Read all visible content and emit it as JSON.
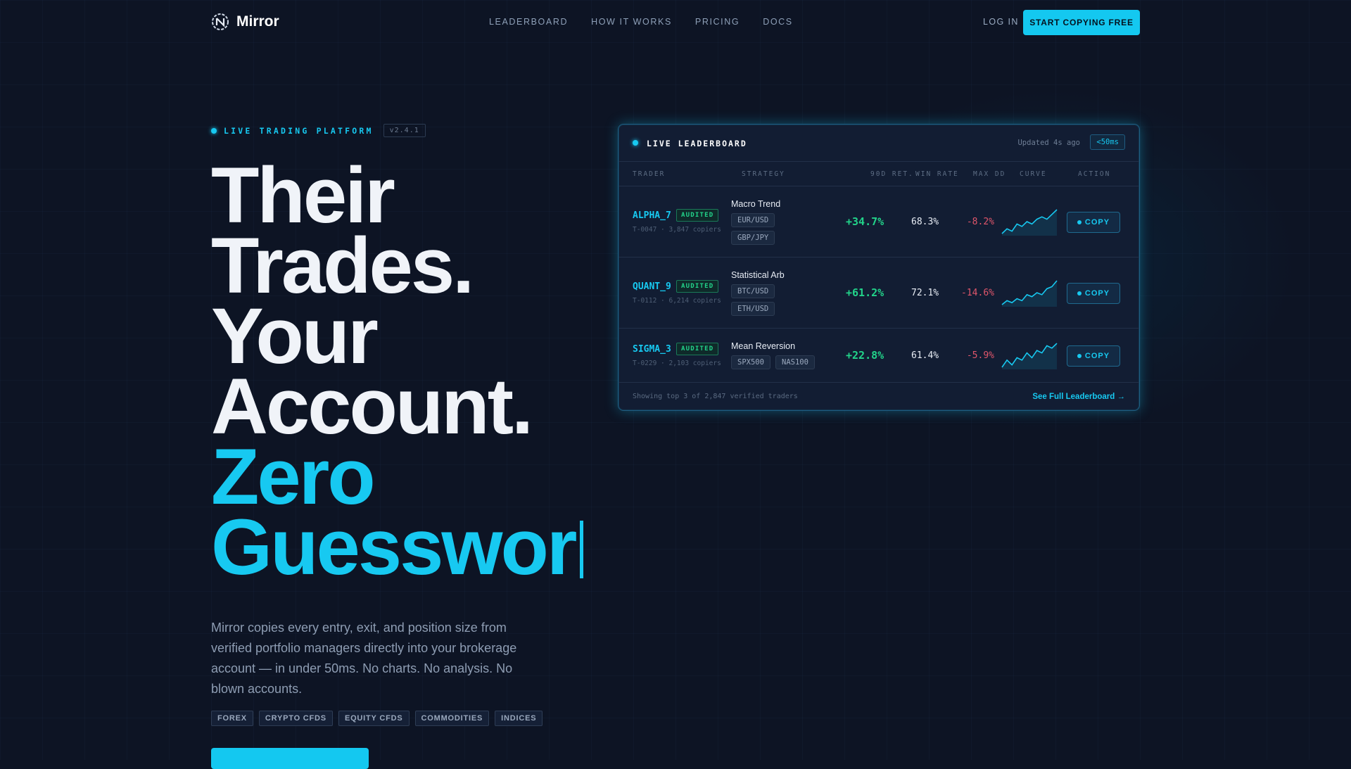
{
  "nav": {
    "brand": "Mirror",
    "links": [
      "LEADERBOARD",
      "HOW IT WORKS",
      "PRICING",
      "DOCS"
    ],
    "login": "LOG IN",
    "cta": "START COPYING FREE"
  },
  "hero": {
    "badge": "LIVE TRADING PLATFORM",
    "version": "v2.4.1",
    "headline_white": [
      "Their",
      "Trades.",
      "Your",
      "Account."
    ],
    "headline_cyan": [
      "Zero",
      "Guesswor"
    ],
    "description": "Mirror copies every entry, exit, and position size from verified portfolio managers directly into your brokerage account — in under 50ms. No charts. No analysis. No blown accounts.",
    "tags": [
      "FOREX",
      "CRYPTO CFDS",
      "EQUITY CFDS",
      "COMMODITIES",
      "INDICES"
    ]
  },
  "leaderboard": {
    "title": "LIVE LEADERBOARD",
    "updated": "Updated 4s ago",
    "latency": "<50ms",
    "columns": [
      "TRADER",
      "STRATEGY",
      "90D RET.",
      "WIN RATE",
      "MAX DD",
      "CURVE",
      "ACTION"
    ],
    "rows": [
      {
        "name": "ALPHA_7",
        "badge": "AUDITED",
        "meta": "T-0047 · 3,847 copiers",
        "strategy": "Macro Trend",
        "pairs": [
          "EUR/USD",
          "GBP/JPY"
        ],
        "ret": "+34.7%",
        "win": "68.3%",
        "dd": "-8.2%",
        "action": "COPY",
        "curve": [
          2,
          4,
          3,
          6,
          5,
          7,
          6,
          8,
          9,
          8,
          10,
          12
        ]
      },
      {
        "name": "QUANT_9",
        "badge": "AUDITED",
        "meta": "T-0112 · 6,214 copiers",
        "strategy": "Statistical Arb",
        "pairs": [
          "BTC/USD",
          "ETH/USD"
        ],
        "ret": "+61.2%",
        "win": "72.1%",
        "dd": "-14.6%",
        "action": "COPY",
        "curve": [
          1,
          3,
          2,
          4,
          3,
          6,
          5,
          7,
          6,
          9,
          10,
          13
        ]
      },
      {
        "name": "SIGMA_3",
        "badge": "AUDITED",
        "meta": "T-0229 · 2,103 copiers",
        "strategy": "Mean Reversion",
        "pairs": [
          "SPX500",
          "NAS100"
        ],
        "ret": "+22.8%",
        "win": "61.4%",
        "dd": "-5.9%",
        "action": "COPY",
        "curve": [
          2,
          5,
          3,
          6,
          5,
          8,
          6,
          9,
          8,
          11,
          10,
          12
        ]
      }
    ],
    "footer_note": "Showing top 3 of 2,847 verified traders",
    "footer_link": "See Full Leaderboard →"
  },
  "colors": {
    "accent": "#17c9f1",
    "positive": "#22d38a",
    "negative": "#e0566b",
    "background": "#0d1424"
  }
}
